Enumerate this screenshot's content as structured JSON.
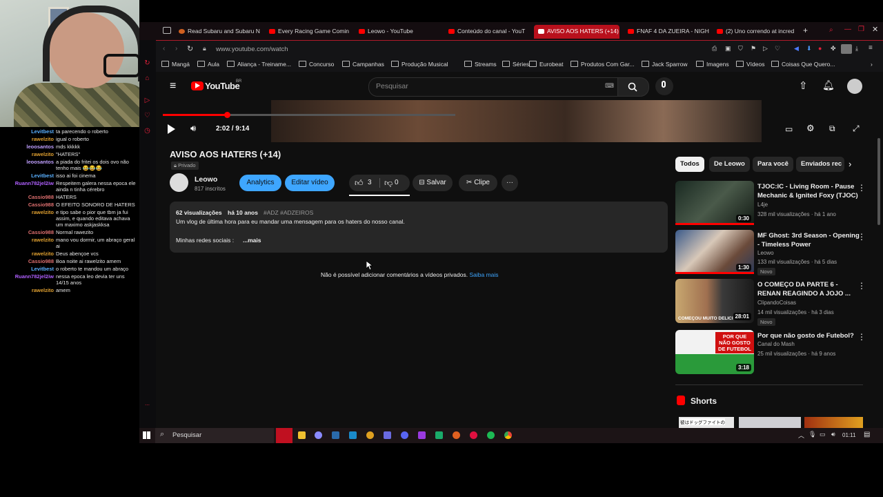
{
  "browser": {
    "tabs": [
      {
        "label": "Read Subaru and Subaru N"
      },
      {
        "label": "Every Racing Game Comin"
      },
      {
        "label": "Leowo - YouTube"
      },
      {
        "label": "Conteúdo do canal - YouT"
      },
      {
        "label": "AVISO AOS HATERS (+14)",
        "active": true
      },
      {
        "label": "FNAF 4 DA ZUEIRA - NIGH"
      },
      {
        "label": "(2) Uno correndo at incred"
      }
    ],
    "url": "www.youtube.com/watch",
    "bookmarks": [
      "Mangá",
      "Aula",
      "Aliança - Treiname...",
      "Concurso",
      "Campanhas",
      "Produção Musical",
      "Streams",
      "Séries",
      "Eurobeat",
      "Produtos Com Gar...",
      "Jack Sparrow",
      "Imagens",
      "Vídeos",
      "Coisas Que Quero..."
    ]
  },
  "chat": [
    {
      "user": "Levitbest",
      "color": "#5ab0ff",
      "msg": "ta parecendo o roberto"
    },
    {
      "user": "rawelzito",
      "color": "#e0a030",
      "msg": "igual o roberto"
    },
    {
      "user": "leoosantos",
      "color": "#c0a0ff",
      "msg": "mds kkkkk"
    },
    {
      "user": "rawelzito",
      "color": "#e0a030",
      "msg": "\"HATERS\""
    },
    {
      "user": "leoosantos",
      "color": "#c0a0ff",
      "msg": "a piada do fritei os dois ovo não tenho mais 😂😂😂"
    },
    {
      "user": "Levitbest",
      "color": "#5ab0ff",
      "msg": "isso ai foi cinema"
    },
    {
      "user": "Ruann782jel2iw",
      "color": "#b060ff",
      "msg": "Respeitem galera nessa epoca ele ainda n tinha cérebro"
    },
    {
      "user": "Cassio988",
      "color": "#e07070",
      "msg": "HATERS"
    },
    {
      "user": "Cassio988",
      "color": "#e07070",
      "msg": "O EFEITO SONORO DE HATERS"
    },
    {
      "user": "rawelzito",
      "color": "#e0a030",
      "msg": "e tipo sabe o pior que tbm ja fui assim, e quando editava achava um maximo askjaskksa"
    },
    {
      "user": "Cassio988",
      "color": "#e07070",
      "msg": "Normal rawezito"
    },
    {
      "user": "rawelzito",
      "color": "#e0a030",
      "msg": "mano vou dormir, um abraço geral ai"
    },
    {
      "user": "rawelzito",
      "color": "#e0a030",
      "msg": "Deus abençoe vcs"
    },
    {
      "user": "Cassio988",
      "color": "#e07070",
      "msg": "Boa noite ai rawelzito amem"
    },
    {
      "user": "Levitbest",
      "color": "#5ab0ff",
      "msg": "o roberto te mandou um abraço"
    },
    {
      "user": "Ruann782jel2iw",
      "color": "#b060ff",
      "msg": "nessa epoca leo devia ter uns 14/15 anos"
    },
    {
      "user": "rawelzito",
      "color": "#e0a030",
      "msg": "amem"
    }
  ],
  "youtube": {
    "logo": "YouTube",
    "region": "BR",
    "search_placeholder": "Pesquisar",
    "time": "2:02 / 9:14",
    "progress": 0.22,
    "title": "AVISO AOS HATERS (+14)",
    "privacy": "Privado",
    "channel": "Leowo",
    "subs": "817 inscritos",
    "analytics": "Analytics",
    "edit": "Editar vídeo",
    "likes": "3",
    "dislikes": "0",
    "save": "Salvar",
    "clip": "Clipe",
    "views": "62 visualizações",
    "age": "há 10 anos",
    "tags": "#ADZ #ADZEIROS",
    "description": "Um vlog de última hora para eu mandar uma mensagem para os haters do nosso canal.",
    "social": "Minhas redes sociais :",
    "more": "...mais",
    "comments_off": "Não é possível adicionar comentários a vídeos privados.",
    "learn_more": "Saiba mais",
    "chips": [
      "Todos",
      "De Leowo",
      "Para você",
      "Enviados rec"
    ],
    "recs": [
      {
        "title": "TJOC:IC - Living Room - Pause Mechanic & Ignited Foxy (TJOC)",
        "channel": "L4je",
        "meta": "328 mil visualizações · há 1 ano",
        "dur": "0:30",
        "new": ""
      },
      {
        "title": "MF Ghost: 3rd Season - Opening - Timeless Power",
        "channel": "Leowo",
        "meta": "133 mil visualizações · há 5 dias",
        "dur": "1:30",
        "new": "Novo"
      },
      {
        "title": "O COMEÇO DA PARTE 6 - RENAN REAGINDO A JOJO ...",
        "channel": "ClipandoCoisas",
        "meta": "14 mil visualizações · há 3 dias",
        "dur": "28:01",
        "new": "Novo",
        "caption": "COMEÇOU MUITO DELICI"
      },
      {
        "title": "Por que não gosto de Futebol?",
        "channel": "Canal do Mash",
        "meta": "25 mil visualizações · há 9 anos",
        "dur": "3:18",
        "new": "",
        "caption": "POR QUE NÃO GOSTO DE FUTEBOL"
      }
    ],
    "shorts": "Shorts",
    "shorts_caption": "彼はドッグファイトの"
  },
  "taskbar": {
    "search": "Pesquisar",
    "clock": "01:11"
  }
}
